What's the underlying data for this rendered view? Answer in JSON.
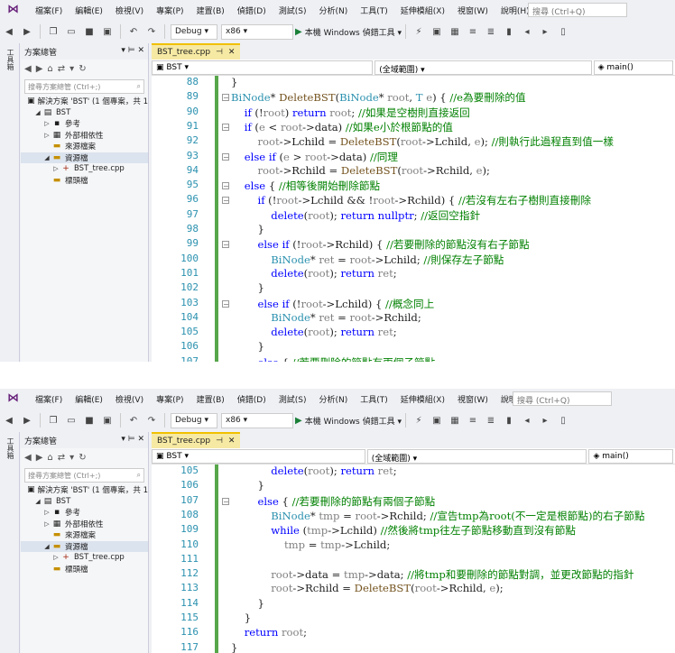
{
  "menu": [
    "檔案(F)",
    "編輯(E)",
    "檢視(V)",
    "專案(P)",
    "建置(B)",
    "偵錯(D)",
    "測試(S)",
    "分析(N)",
    "工具(T)",
    "延伸模組(X)",
    "視窗(W)",
    "說明(H)"
  ],
  "search_placeholder": "搜尋 (Ctrl+Q)",
  "toolbar": {
    "config": "Debug",
    "platform": "x86",
    "run": "本機 Windows 偵錯工具"
  },
  "left_strip": "工具箱",
  "solution_explorer": {
    "title": "方案總管",
    "pin": "▾ ⊨ ✕",
    "search": "搜尋方案總管 (Ctrl+;)",
    "items": [
      "解決方案 'BST' (1 個專案，共 1",
      "BST",
      "參考",
      "外部相依性",
      "來源檔案",
      "資源檔",
      "BST_tree.cpp",
      "標頭檔"
    ]
  },
  "editor": {
    "tab": "BST_tree.cpp",
    "tab_close": "✕",
    "nav_project": "BST",
    "nav_scope": "(全域範圍)",
    "nav_func": "main()"
  },
  "top_lines": [
    [
      88,
      "",
      "}"
    ],
    [
      89,
      "fold",
      "BiNode* DeleteBST(BiNode* root, T e) { //e為要刪除的值"
    ],
    [
      90,
      "",
      "    if (!root) return root; //如果是空樹則直接返回"
    ],
    [
      91,
      "fold",
      "    if (e < root->data) //如果e小於根節點的值"
    ],
    [
      92,
      "",
      "        root->Lchild = DeleteBST(root->Lchild, e); //則執行此過程直到值一樣"
    ],
    [
      93,
      "fold",
      "    else if (e > root->data) //同理"
    ],
    [
      94,
      "",
      "        root->Rchild = DeleteBST(root->Rchild, e);"
    ],
    [
      95,
      "fold",
      "    else { //相等後開始刪除節點"
    ],
    [
      96,
      "fold",
      "        if (!root->Lchild && !root->Rchild) { //若沒有左右子樹則直接刪除"
    ],
    [
      97,
      "",
      "            delete(root); return nullptr; //返回空指針"
    ],
    [
      98,
      "",
      "        }"
    ],
    [
      99,
      "fold",
      "        else if (!root->Rchild) { //若要刪除的節點沒有右子節點"
    ],
    [
      100,
      "",
      "            BiNode* ret = root->Lchild; //則保存左子節點"
    ],
    [
      101,
      "",
      "            delete(root); return ret;"
    ],
    [
      102,
      "",
      "        }"
    ],
    [
      103,
      "fold",
      "        else if (!root->Lchild) { //概念同上"
    ],
    [
      104,
      "",
      "            BiNode* ret = root->Rchild;"
    ],
    [
      105,
      "",
      "            delete(root); return ret;"
    ],
    [
      106,
      "",
      "        }"
    ],
    [
      107,
      "",
      "        else { //若要刪除的節點有兩個子節點"
    ]
  ],
  "bottom_lines": [
    [
      105,
      "",
      "            delete(root); return ret;"
    ],
    [
      106,
      "",
      "        }"
    ],
    [
      107,
      "fold",
      "        else { //若要刪除的節點有兩個子節點"
    ],
    [
      108,
      "",
      "            BiNode* tmp = root->Rchild; //宣告tmp為root(不一定是根節點)的右子節點"
    ],
    [
      109,
      "",
      "            while (tmp->Lchild) //然後將tmp往左子節點移動直到沒有節點"
    ],
    [
      110,
      "",
      "                tmp = tmp->Lchild;"
    ],
    [
      111,
      "",
      ""
    ],
    [
      112,
      "",
      "            root->data = tmp->data; //將tmp和要刪除的節點對調，並更改節點的指針"
    ],
    [
      113,
      "",
      "            root->Rchild = DeleteBST(root->Rchild, e);"
    ],
    [
      114,
      "",
      "        }"
    ],
    [
      115,
      "",
      "    }"
    ],
    [
      116,
      "",
      "    return root;"
    ],
    [
      117,
      "",
      "}"
    ]
  ]
}
